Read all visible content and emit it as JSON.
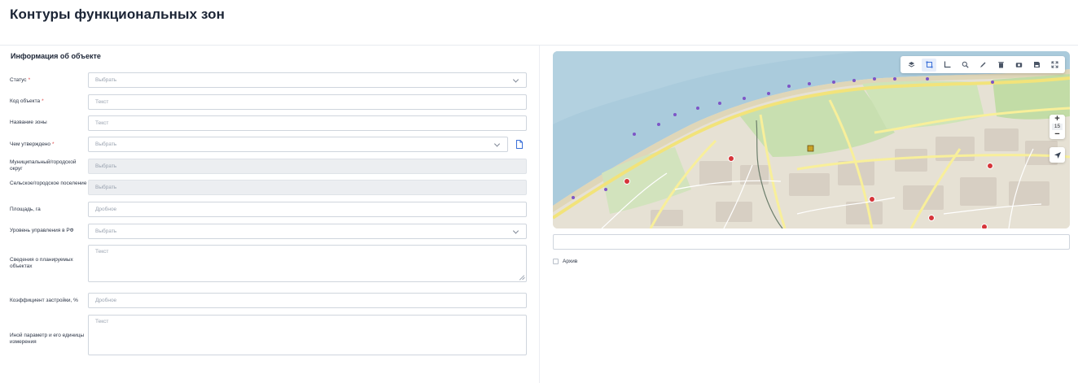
{
  "page": {
    "title": "Контуры функциональных зон"
  },
  "section": {
    "title": "Информация об объекте"
  },
  "form": {
    "status": {
      "label": "Статус",
      "required": "*",
      "value": "Выбрать"
    },
    "object_code": {
      "label": "Код объекта",
      "required": "*",
      "value": "Текст"
    },
    "zone_name": {
      "label": "Название зоны",
      "value": "Текст"
    },
    "approved_by": {
      "label": "Чем утверждено",
      "required": "*",
      "value": "Выбрать"
    },
    "municipal": {
      "label": "Муниципальный/городской округ",
      "value": "Выбрать"
    },
    "settlement": {
      "label": "Сельское/городское поселение",
      "value": "Выбрать"
    },
    "area": {
      "label": "Площадь, га",
      "value": "Дробное"
    },
    "gov_level": {
      "label": "Уровень управления в РФ",
      "value": "Выбрать"
    },
    "planned": {
      "label": "Сведения о планируемых объектах",
      "value": "Текст"
    },
    "build_coef": {
      "label": "Коэффициент застройки, %",
      "value": "Дробное"
    },
    "other_param": {
      "label": "Иной параметр и его единицы измерения",
      "value": "Текст"
    }
  },
  "map": {
    "zoom_in": "+",
    "zoom_level": "15",
    "zoom_out": "−",
    "toolbar_icons": [
      "layers-icon",
      "select-area-icon",
      "measure-icon",
      "search-icon",
      "draw-icon",
      "delete-icon",
      "camera-icon",
      "save-icon",
      "fullscreen-icon"
    ],
    "colors": {
      "water": "#aacbdc",
      "land": "#e6e1d4",
      "park": "#c8dfb0",
      "road": "#f8ef9a",
      "marker": "#d6353a"
    }
  },
  "archive": {
    "label": "Архив",
    "checked": false
  }
}
